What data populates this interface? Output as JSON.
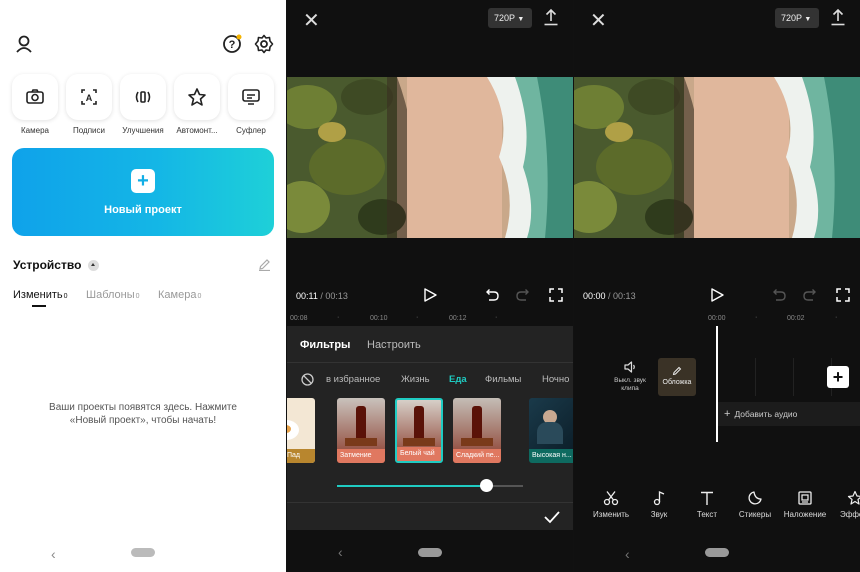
{
  "home": {
    "quick_actions": [
      {
        "label": "Камера",
        "icon": "camera-icon"
      },
      {
        "label": "Подписи",
        "icon": "captions-icon"
      },
      {
        "label": "Улучшения",
        "icon": "enhance-icon"
      },
      {
        "label": "Автомонт...",
        "icon": "automont-icon"
      },
      {
        "label": "Суфлер",
        "icon": "teleprompter-icon"
      }
    ],
    "new_project": "Новый проект",
    "device_title": "Устройство",
    "tabs": [
      {
        "label": "Изменить",
        "count": "0"
      },
      {
        "label": "Шаблоны",
        "count": "0"
      },
      {
        "label": "Камера",
        "count": "0"
      }
    ],
    "empty_message": "Ваши проекты появятся здесь. Нажмите «Новый проект», чтобы начать!",
    "accent": "#12aee6"
  },
  "editor_filters": {
    "resolution": "720P",
    "time_current": "00:11",
    "time_total": "/ 00:13",
    "ruler_ticks": [
      "00:08",
      "00:10",
      "00:12"
    ],
    "sheet_tabs": [
      "Фильтры",
      "Настроить"
    ],
    "categories": [
      "в избранное",
      "Жизнь",
      "Еда",
      "Фильмы",
      "Ночно"
    ],
    "active_category": "Еда",
    "filters": [
      {
        "label": "Пад"
      },
      {
        "label": "Затмение"
      },
      {
        "label": "Белый чай",
        "selected": true
      },
      {
        "label": "Сладкий пе..."
      },
      {
        "label": "Высокая н..."
      }
    ],
    "intensity": 0.8,
    "accent": "#1fcbc2"
  },
  "editor_timeline": {
    "resolution": "720P",
    "time_current": "00:00",
    "time_total": "/ 00:13",
    "ruler_ticks": [
      "00:00",
      "00:02"
    ],
    "mute_label": "Выкл. звук клипа",
    "cover_label": "Обложка",
    "add_audio": "Добавить аудио",
    "tools": [
      {
        "label": "Изменить",
        "icon": "scissors-icon"
      },
      {
        "label": "Звук",
        "icon": "music-note-icon"
      },
      {
        "label": "Текст",
        "icon": "text-icon"
      },
      {
        "label": "Стикеры",
        "icon": "sticker-icon"
      },
      {
        "label": "Наложение",
        "icon": "overlay-icon"
      },
      {
        "label": "Эффе",
        "icon": "effects-icon"
      }
    ]
  }
}
